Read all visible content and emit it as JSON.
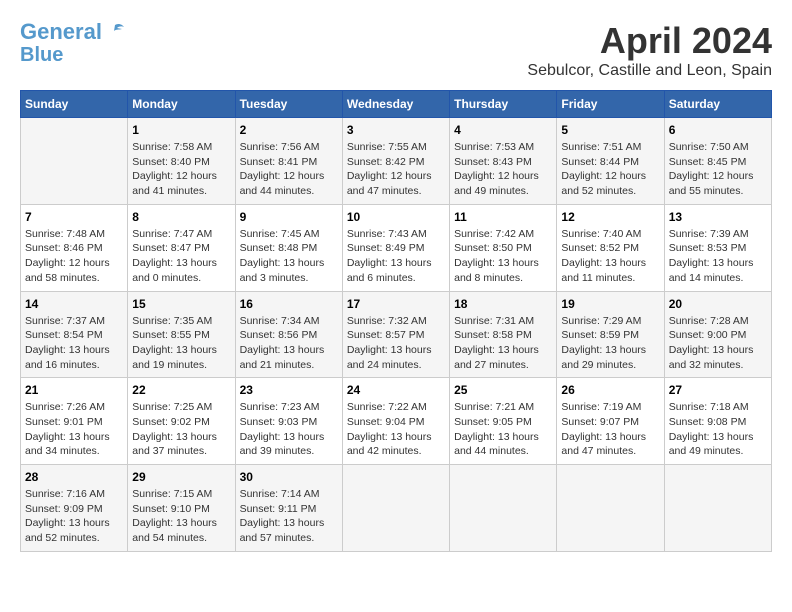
{
  "logo": {
    "line1": "General",
    "line2": "Blue"
  },
  "title": "April 2024",
  "subtitle": "Sebulcor, Castille and Leon, Spain",
  "headers": [
    "Sunday",
    "Monday",
    "Tuesday",
    "Wednesday",
    "Thursday",
    "Friday",
    "Saturday"
  ],
  "weeks": [
    [
      {
        "day": "",
        "info": ""
      },
      {
        "day": "1",
        "info": "Sunrise: 7:58 AM\nSunset: 8:40 PM\nDaylight: 12 hours\nand 41 minutes."
      },
      {
        "day": "2",
        "info": "Sunrise: 7:56 AM\nSunset: 8:41 PM\nDaylight: 12 hours\nand 44 minutes."
      },
      {
        "day": "3",
        "info": "Sunrise: 7:55 AM\nSunset: 8:42 PM\nDaylight: 12 hours\nand 47 minutes."
      },
      {
        "day": "4",
        "info": "Sunrise: 7:53 AM\nSunset: 8:43 PM\nDaylight: 12 hours\nand 49 minutes."
      },
      {
        "day": "5",
        "info": "Sunrise: 7:51 AM\nSunset: 8:44 PM\nDaylight: 12 hours\nand 52 minutes."
      },
      {
        "day": "6",
        "info": "Sunrise: 7:50 AM\nSunset: 8:45 PM\nDaylight: 12 hours\nand 55 minutes."
      }
    ],
    [
      {
        "day": "7",
        "info": "Sunrise: 7:48 AM\nSunset: 8:46 PM\nDaylight: 12 hours\nand 58 minutes."
      },
      {
        "day": "8",
        "info": "Sunrise: 7:47 AM\nSunset: 8:47 PM\nDaylight: 13 hours\nand 0 minutes."
      },
      {
        "day": "9",
        "info": "Sunrise: 7:45 AM\nSunset: 8:48 PM\nDaylight: 13 hours\nand 3 minutes."
      },
      {
        "day": "10",
        "info": "Sunrise: 7:43 AM\nSunset: 8:49 PM\nDaylight: 13 hours\nand 6 minutes."
      },
      {
        "day": "11",
        "info": "Sunrise: 7:42 AM\nSunset: 8:50 PM\nDaylight: 13 hours\nand 8 minutes."
      },
      {
        "day": "12",
        "info": "Sunrise: 7:40 AM\nSunset: 8:52 PM\nDaylight: 13 hours\nand 11 minutes."
      },
      {
        "day": "13",
        "info": "Sunrise: 7:39 AM\nSunset: 8:53 PM\nDaylight: 13 hours\nand 14 minutes."
      }
    ],
    [
      {
        "day": "14",
        "info": "Sunrise: 7:37 AM\nSunset: 8:54 PM\nDaylight: 13 hours\nand 16 minutes."
      },
      {
        "day": "15",
        "info": "Sunrise: 7:35 AM\nSunset: 8:55 PM\nDaylight: 13 hours\nand 19 minutes."
      },
      {
        "day": "16",
        "info": "Sunrise: 7:34 AM\nSunset: 8:56 PM\nDaylight: 13 hours\nand 21 minutes."
      },
      {
        "day": "17",
        "info": "Sunrise: 7:32 AM\nSunset: 8:57 PM\nDaylight: 13 hours\nand 24 minutes."
      },
      {
        "day": "18",
        "info": "Sunrise: 7:31 AM\nSunset: 8:58 PM\nDaylight: 13 hours\nand 27 minutes."
      },
      {
        "day": "19",
        "info": "Sunrise: 7:29 AM\nSunset: 8:59 PM\nDaylight: 13 hours\nand 29 minutes."
      },
      {
        "day": "20",
        "info": "Sunrise: 7:28 AM\nSunset: 9:00 PM\nDaylight: 13 hours\nand 32 minutes."
      }
    ],
    [
      {
        "day": "21",
        "info": "Sunrise: 7:26 AM\nSunset: 9:01 PM\nDaylight: 13 hours\nand 34 minutes."
      },
      {
        "day": "22",
        "info": "Sunrise: 7:25 AM\nSunset: 9:02 PM\nDaylight: 13 hours\nand 37 minutes."
      },
      {
        "day": "23",
        "info": "Sunrise: 7:23 AM\nSunset: 9:03 PM\nDaylight: 13 hours\nand 39 minutes."
      },
      {
        "day": "24",
        "info": "Sunrise: 7:22 AM\nSunset: 9:04 PM\nDaylight: 13 hours\nand 42 minutes."
      },
      {
        "day": "25",
        "info": "Sunrise: 7:21 AM\nSunset: 9:05 PM\nDaylight: 13 hours\nand 44 minutes."
      },
      {
        "day": "26",
        "info": "Sunrise: 7:19 AM\nSunset: 9:07 PM\nDaylight: 13 hours\nand 47 minutes."
      },
      {
        "day": "27",
        "info": "Sunrise: 7:18 AM\nSunset: 9:08 PM\nDaylight: 13 hours\nand 49 minutes."
      }
    ],
    [
      {
        "day": "28",
        "info": "Sunrise: 7:16 AM\nSunset: 9:09 PM\nDaylight: 13 hours\nand 52 minutes."
      },
      {
        "day": "29",
        "info": "Sunrise: 7:15 AM\nSunset: 9:10 PM\nDaylight: 13 hours\nand 54 minutes."
      },
      {
        "day": "30",
        "info": "Sunrise: 7:14 AM\nSunset: 9:11 PM\nDaylight: 13 hours\nand 57 minutes."
      },
      {
        "day": "",
        "info": ""
      },
      {
        "day": "",
        "info": ""
      },
      {
        "day": "",
        "info": ""
      },
      {
        "day": "",
        "info": ""
      }
    ]
  ]
}
